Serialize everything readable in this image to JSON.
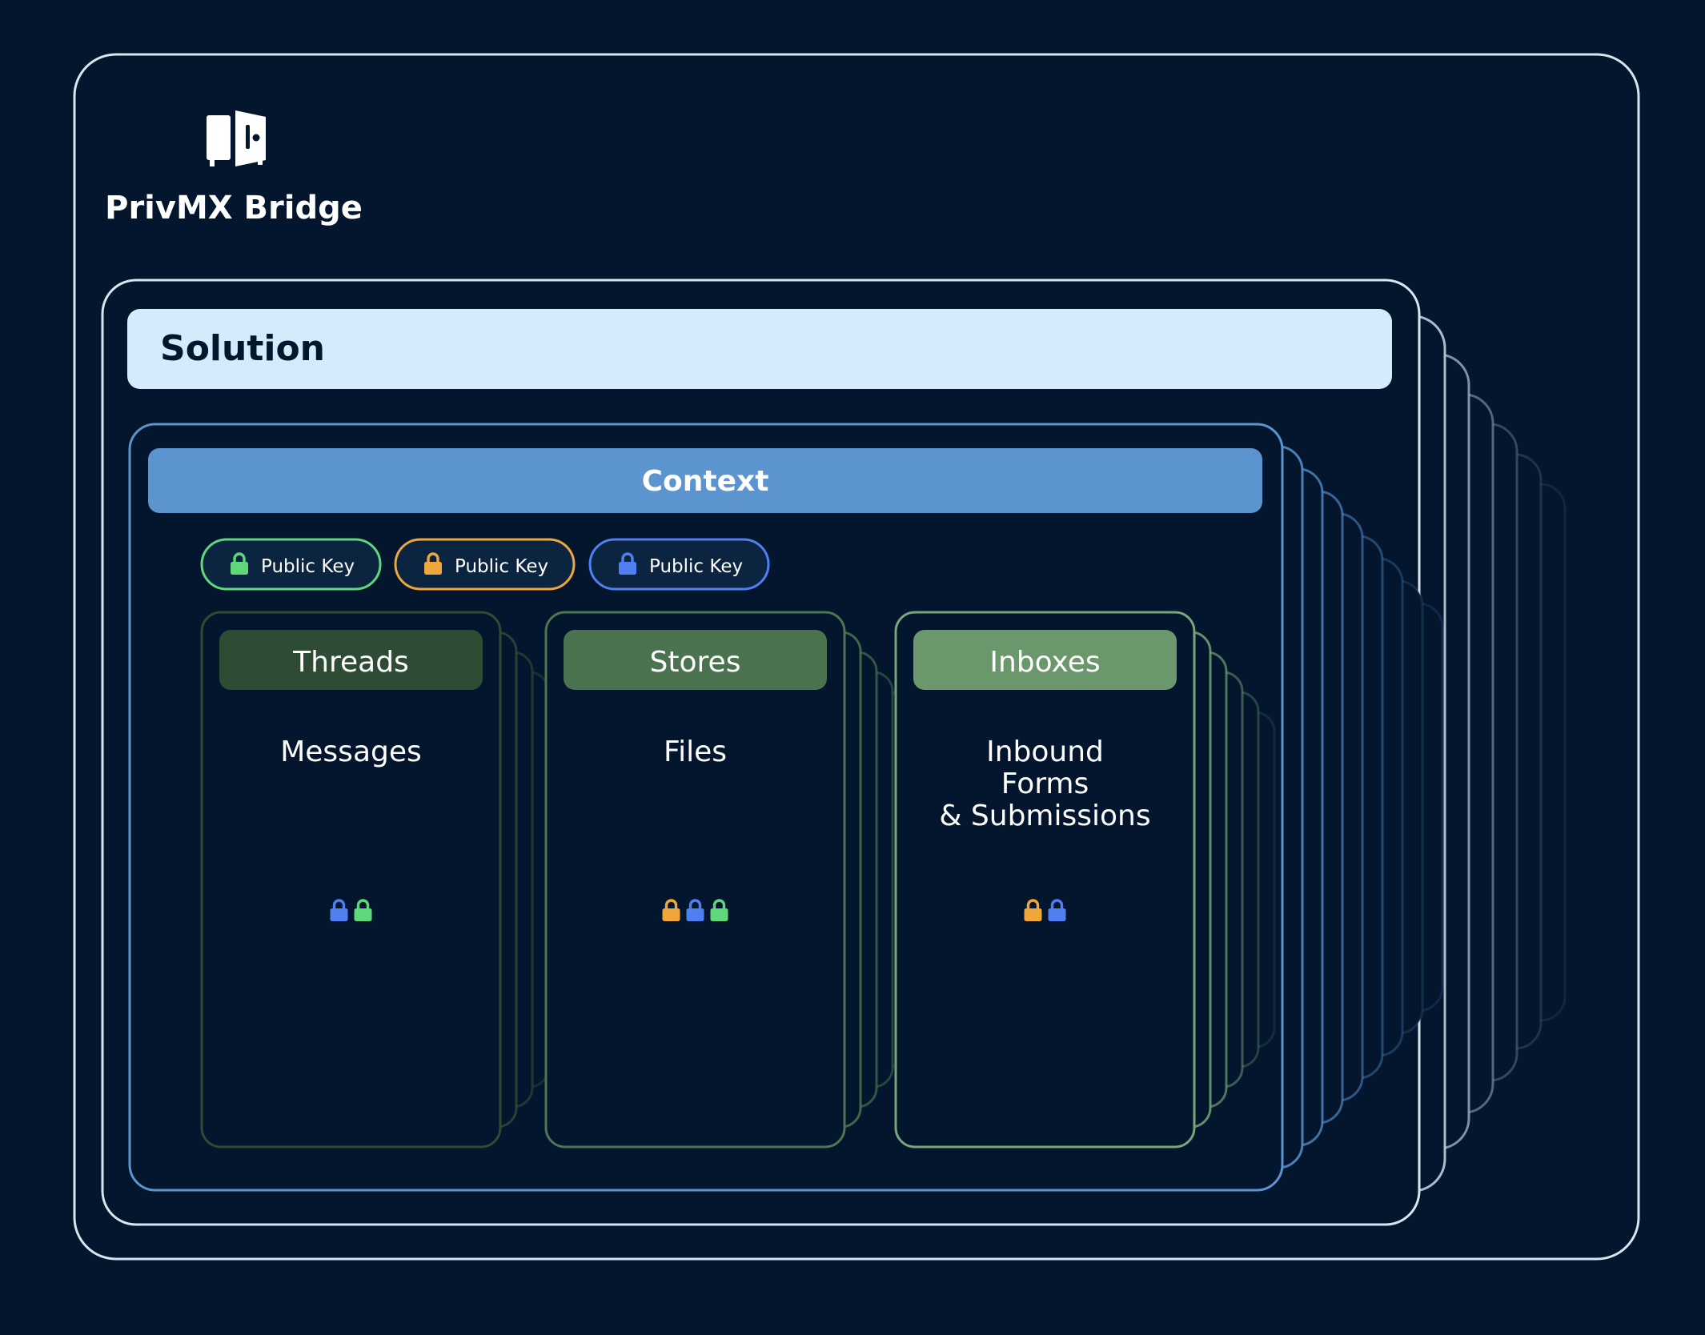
{
  "bridge": {
    "title": "PrivMX Bridge",
    "icon": "safe-vault-icon"
  },
  "solution": {
    "label": "Solution"
  },
  "context": {
    "label": "Context"
  },
  "public_keys": [
    {
      "label": "Public Key",
      "color": "#5fd77b",
      "icon": "lock-icon"
    },
    {
      "label": "Public Key",
      "color": "#efa73c",
      "icon": "lock-icon"
    },
    {
      "label": "Public Key",
      "color": "#4f7ff0",
      "icon": "lock-icon"
    }
  ],
  "containers": [
    {
      "title": "Threads",
      "body_lines": [
        "Messages"
      ],
      "header_color": "#2d4c33",
      "border_color": "#2f4b35",
      "locks": [
        "#4f7ff0",
        "#5fd77b"
      ]
    },
    {
      "title": "Stores",
      "body_lines": [
        "Files"
      ],
      "header_color": "#4b7350",
      "border_color": "#4e7652",
      "locks": [
        "#efa73c",
        "#4f7ff0",
        "#5fd77b"
      ]
    },
    {
      "title": "Inboxes",
      "body_lines": [
        "Inbound",
        "Forms",
        "& Submissions"
      ],
      "header_color": "#6a976c",
      "border_color": "#78a67a",
      "locks": [
        "#efa73c",
        "#4f7ff0"
      ]
    }
  ],
  "colors": {
    "background": "#03162d",
    "bridge_border": "#d9e6ef",
    "solution_bar": "#d4ebfb",
    "context_bar": "#5b94cf",
    "context_border": "#5b94cf"
  }
}
